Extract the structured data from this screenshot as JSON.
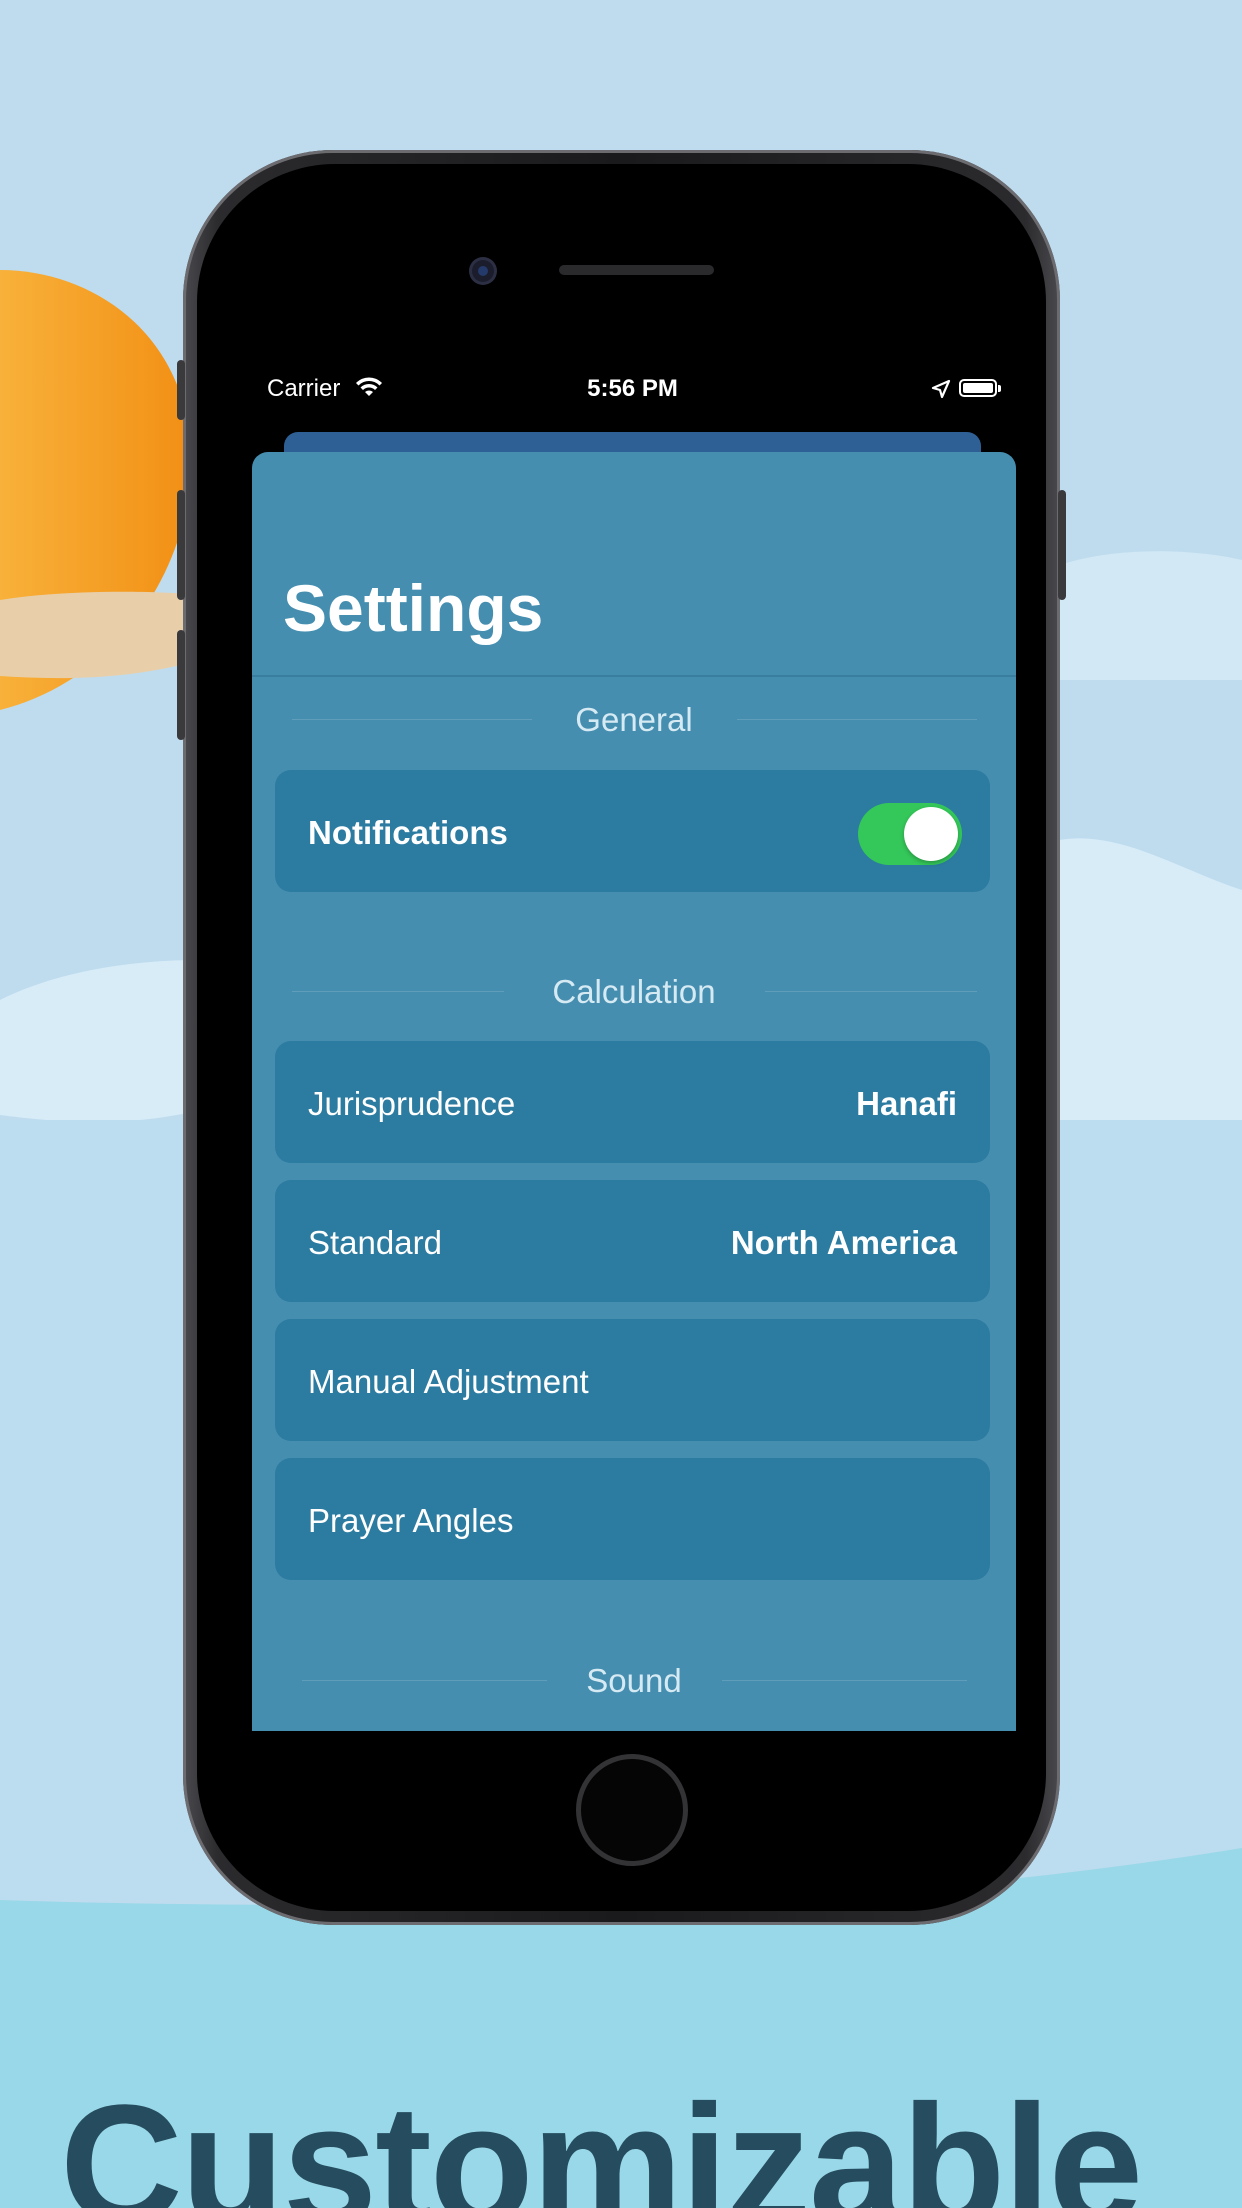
{
  "headline": "Customizable",
  "status_bar": {
    "carrier": "Carrier",
    "time": "5:56 PM"
  },
  "settings": {
    "title": "Settings",
    "sections": {
      "general": "General",
      "calculation": "Calculation",
      "sound": "Sound"
    },
    "notifications": {
      "label": "Notifications",
      "enabled": true
    },
    "jurisprudence": {
      "label": "Jurisprudence",
      "value": "Hanafi"
    },
    "standard": {
      "label": "Standard",
      "value": "North America"
    },
    "manual_adjustment": {
      "label": "Manual Adjustment"
    },
    "prayer_angles": {
      "label": "Prayer Angles"
    }
  },
  "colors": {
    "sky": "#bfdcef",
    "sun": "#f59a1c",
    "sheet": "#458eb0",
    "row": "#2c7ba0",
    "toggle_on": "#34c759",
    "headline": "#264d5f"
  },
  "icons": [
    "wifi-icon",
    "location-arrow-icon",
    "battery-icon"
  ]
}
